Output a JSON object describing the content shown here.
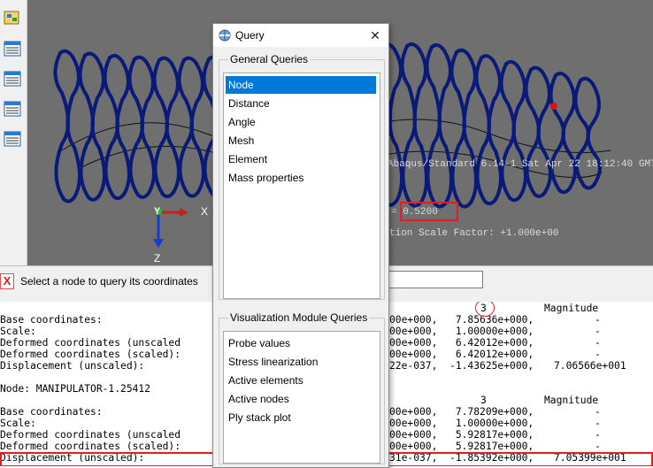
{
  "viewport": {
    "header_text": "Abaqus/Standard 6.14-1    Sat Apr 22 18:12:40 GMT",
    "step_time_text": "= 0.5200",
    "deformation_text": "tion Scale Factor: +1.000e+00",
    "triad": {
      "x_label": "X",
      "y_label": "Y",
      "z_label": "Z"
    }
  },
  "toolbox": {
    "icons": [
      "query-tool-icon",
      "table-icon",
      "table-icon",
      "table-icon",
      "table-icon"
    ]
  },
  "prompt": {
    "cancel_symbol": "X",
    "text": "Select a node to query its coordinates",
    "input_value": ""
  },
  "console": {
    "lines": [
      {
        "left": "",
        "right": "3",
        "right2": "Magnitude"
      },
      {
        "left": "Base coordinates:",
        "right": "00e+000,   7.85636e+000,",
        "right2": "-"
      },
      {
        "left": "Scale:",
        "right": "00e+000,   1.00000e+000,",
        "right2": "-"
      },
      {
        "left": "Deformed coordinates (unscaled",
        "right": "00e+000,   6.42012e+000,",
        "right2": "-"
      },
      {
        "left": "Deformed coordinates (scaled):",
        "right": "00e+000,   6.42012e+000,",
        "right2": "-"
      },
      {
        "left": "Displacement (unscaled):",
        "right": "22e-037,  -1.43625e+000,",
        "right2": "7.06566e+001"
      },
      {
        "left": "",
        "right": "",
        "right2": ""
      },
      {
        "left": "Node: MANIPULATOR-1.25412",
        "right": "",
        "right2": ""
      },
      {
        "left": "",
        "right": "3",
        "right2": "Magnitude"
      },
      {
        "left": "Base coordinates:",
        "right": "00e+000,   7.78209e+000,",
        "right2": "-"
      },
      {
        "left": "Scale:",
        "right": "00e+000,   1.00000e+000,",
        "right2": "-"
      },
      {
        "left": "Deformed coordinates (unscaled",
        "right": "00e+000,   5.92817e+000,",
        "right2": "-"
      },
      {
        "left": "Deformed coordinates (scaled):",
        "right": "00e+000,   5.92817e+000,",
        "right2": "-"
      },
      {
        "left": "Displacement (unscaled):",
        "right": "31e-037,  -1.85392e+000,",
        "right2": "7.05399e+001"
      }
    ]
  },
  "query_dialog": {
    "title": "Query",
    "close_symbol": "✕",
    "general_label": "General Queries",
    "general_items": [
      {
        "label": "Node",
        "selected": true
      },
      {
        "label": "Distance",
        "selected": false
      },
      {
        "label": "Angle",
        "selected": false
      },
      {
        "label": "Mesh",
        "selected": false
      },
      {
        "label": "Element",
        "selected": false
      },
      {
        "label": "Mass properties",
        "selected": false
      }
    ],
    "viz_label": "Visualization Module Queries",
    "viz_items": [
      {
        "label": "Probe values"
      },
      {
        "label": "Stress linearization"
      },
      {
        "label": "Active elements"
      },
      {
        "label": "Active nodes"
      },
      {
        "label": "Ply stack plot"
      }
    ]
  },
  "colors": {
    "mesh": "#0a1a78",
    "viewport_bg": "#6f6f6f",
    "annotation": "#e02020",
    "selection": "#0078d7"
  }
}
